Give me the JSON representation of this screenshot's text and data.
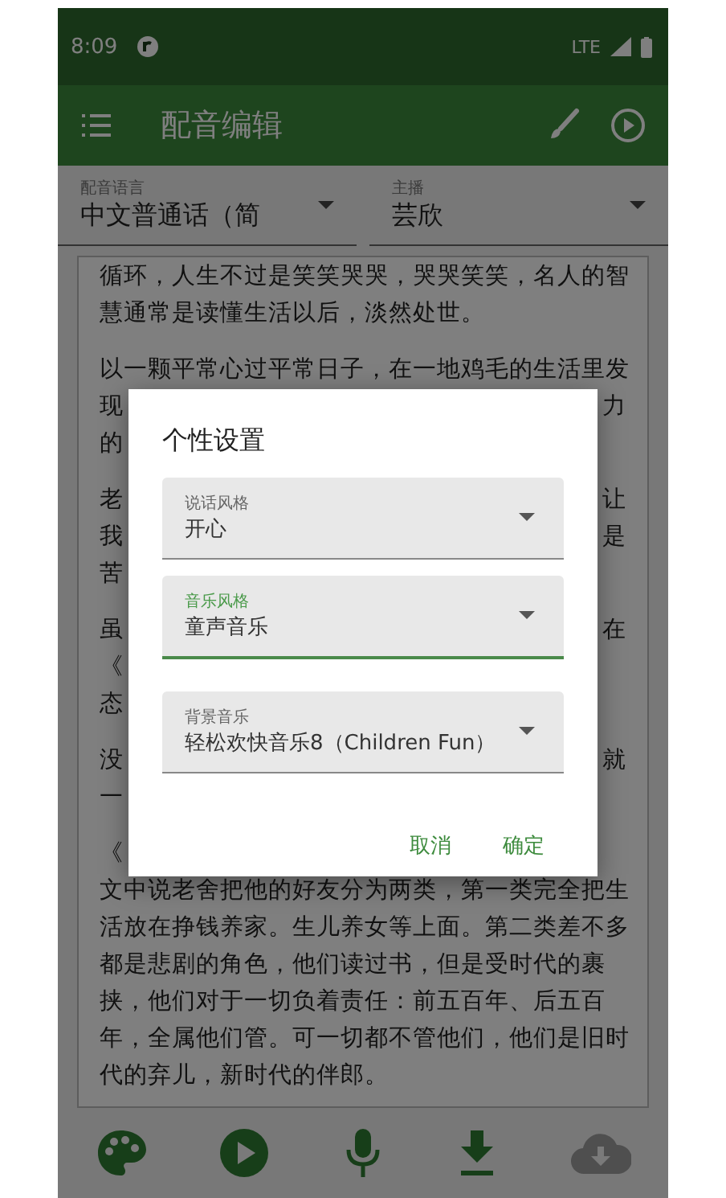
{
  "status_bar": {
    "time": "8:09",
    "network": "LTE"
  },
  "app_bar": {
    "title": "配音编辑"
  },
  "selectors": [
    {
      "label": "配音语言",
      "value": "中文普通话（简"
    },
    {
      "label": "主播",
      "value": "芸欣"
    }
  ],
  "paragraphs": [
    [
      {
        "left": "循环，人生不过是笑笑哭哭，哭哭笑笑，名人的智"
      },
      {
        "left": "慧通常是读懂生活以后，淡然处世。"
      }
    ],
    [
      {
        "left": "以一颗平常心过平常日子，在一地鸡毛的生活里发"
      },
      {
        "left": "现",
        "right": "力"
      },
      {
        "left": "的"
      }
    ],
    [
      {
        "left": "老",
        "right": "让"
      },
      {
        "left": "我",
        "right": "是"
      },
      {
        "left": "苦"
      }
    ],
    [
      {
        "left": "虽",
        "right": "在"
      },
      {
        "left": "《"
      },
      {
        "left": "态"
      }
    ],
    [
      {
        "left": "没",
        "right": "就"
      },
      {
        "left": "一"
      }
    ],
    [
      {
        "left": "《"
      },
      {
        "left": "文中说老舍把他的好友分为两类，第一类完全把生"
      },
      {
        "left": "活放在挣钱养家。生儿养女等上面。第二类差不多"
      },
      {
        "left": "都是悲剧的角色，他们读过书，但是受时代的裹"
      },
      {
        "left": "挟，他们对于一切负着责任：前五百年、后五百"
      },
      {
        "left": "年，全属他们管。可一切都不管他们，他们是旧时"
      },
      {
        "left": "代的弃儿，新时代的伴郎。"
      }
    ]
  ],
  "bottom_bar": [
    {
      "kind": "palette",
      "disabled": false
    },
    {
      "kind": "play",
      "disabled": false
    },
    {
      "kind": "mic",
      "disabled": false
    },
    {
      "kind": "download",
      "disabled": false
    },
    {
      "kind": "cloud",
      "disabled": true
    }
  ],
  "dialog": {
    "title": "个性设置",
    "fields": [
      {
        "label": "说话风格",
        "value": "开心",
        "focused": false
      },
      {
        "label": "音乐风格",
        "value": "童声音乐",
        "focused": true
      },
      {
        "label": "背景音乐",
        "value": "轻松欢快音乐8（Children Fun）",
        "focused": false
      }
    ],
    "buttons": [
      "取消",
      "确定"
    ]
  }
}
